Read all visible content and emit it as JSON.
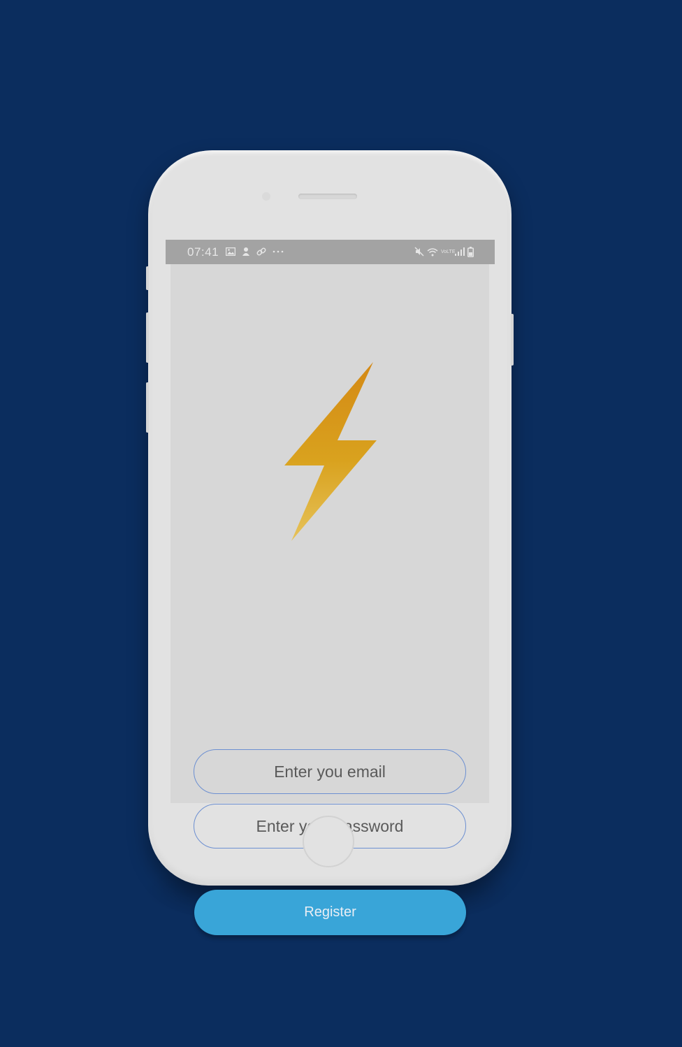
{
  "status_bar": {
    "time": "07:41",
    "left_icons": [
      "image-icon",
      "notification-icon",
      "link-icon",
      "more-icon"
    ],
    "right_icons": [
      "mute-icon",
      "wifi-icon",
      "volte-icon",
      "signal-icon",
      "battery-icon"
    ],
    "volte_text": "VoLTE"
  },
  "form": {
    "email_placeholder": "Enter you email",
    "password_placeholder": "Enter your password",
    "register_label": "Register"
  },
  "colors": {
    "background": "#0b2d5e",
    "accent": "#39a5d8",
    "input_border": "#6c8fd1",
    "logo_gradient_top": "#d48915",
    "logo_gradient_bottom": "#e6c25a"
  }
}
